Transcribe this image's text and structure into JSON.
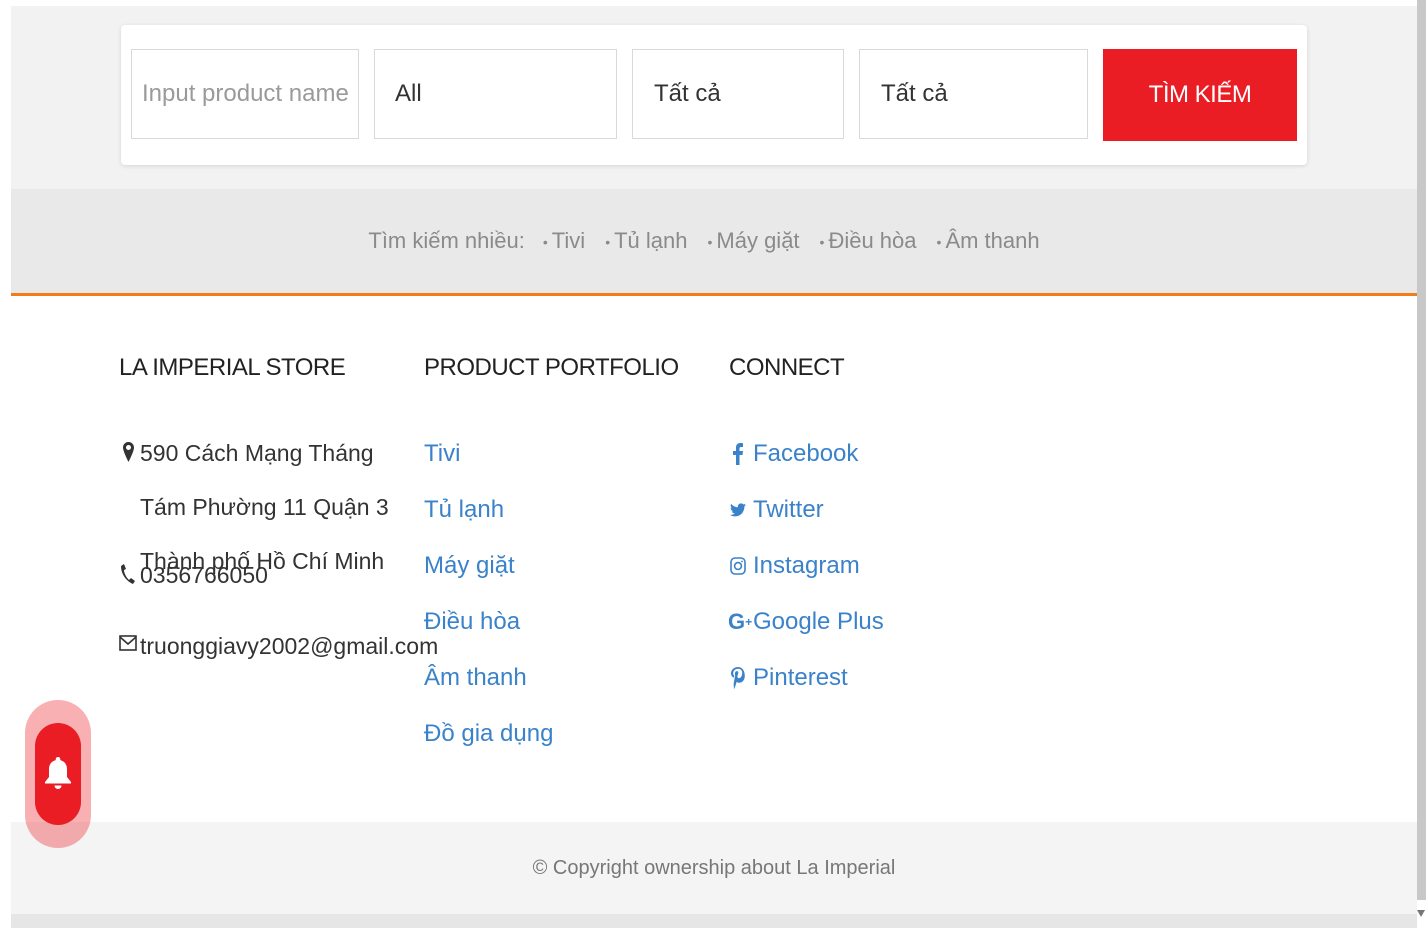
{
  "search": {
    "product_placeholder": "Input product name",
    "category_value": "All",
    "filter1_value": "Tất cả",
    "filter2_value": "Tất cả",
    "button_label": "TÌM KIẾM"
  },
  "popular": {
    "label": "Tìm kiếm nhiều:",
    "items": [
      "Tivi",
      "Tủ lạnh",
      "Máy giặt",
      "Điều hòa",
      "Âm thanh"
    ]
  },
  "store": {
    "title": "LA IMPERIAL STORE",
    "address": "590 Cách Mạng Tháng Tám Phường 11 Quận 3 Thành phố Hồ Chí Minh",
    "phone": "0356766050",
    "email": "truonggiavy2002@gmail.com"
  },
  "portfolio": {
    "title": "PRODUCT PORTFOLIO",
    "items": [
      "Tivi",
      "Tủ lạnh",
      "Máy giặt",
      "Điều hòa",
      "Âm thanh",
      "Đồ gia dụng"
    ]
  },
  "connect": {
    "title": "CONNECT",
    "items": [
      {
        "label": "Facebook",
        "icon": "facebook-icon"
      },
      {
        "label": "Twitter",
        "icon": "twitter-icon"
      },
      {
        "label": "Instagram",
        "icon": "instagram-icon"
      },
      {
        "label": "Google Plus",
        "icon": "google-plus-icon"
      },
      {
        "label": "Pinterest",
        "icon": "pinterest-icon"
      }
    ]
  },
  "footer": {
    "copyright": "© Copyright ownership about La Imperial"
  },
  "colors": {
    "accent_red": "#ea1c24",
    "accent_orange": "#f07d1a",
    "link_blue": "#3a82c9"
  }
}
